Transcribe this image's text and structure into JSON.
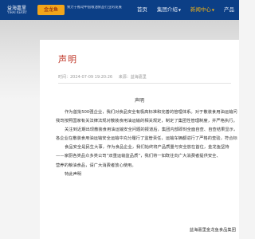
{
  "header": {
    "brand_cn": "益海嘉里",
    "brand_en": "YIHAI KERRY",
    "badge_text": "金龙鱼",
    "tagline": "致力于推动中国粮油食品行业的发展",
    "nav": [
      {
        "label": "首页",
        "active": false,
        "caret": false
      },
      {
        "label": "集团介绍",
        "active": false,
        "caret": true
      },
      {
        "label": "新闻中心",
        "active": true,
        "caret": true
      },
      {
        "label": "产品",
        "active": false,
        "caret": false
      }
    ]
  },
  "article": {
    "title": "声明",
    "date": "时间：2024-07-09 19:20:26",
    "source": "来源：益海嘉里",
    "doc_title": "声明",
    "paragraphs": [
      {
        "text": "作为首批500强企业，我们对食品安全有极高标准和完善的管理体系。对于散装食用油运输问题，",
        "indent": true
      },
      {
        "text": "我司按照国家有关法律法规对散装食用油运输的相关规定，制定了集团性管理制度，并严格执行。",
        "indent": false
      },
      {
        "text": "关注到近期出现散装食用油运输安全问题的报道后，集团内部即刻全面自查、自查结果显示，",
        "indent": true
      },
      {
        "text": "各企业在散装食用油运输安全运输中充分履行了监管责任，运输车辆都进行了严格的查验，符合标准。",
        "indent": false
      },
      {
        "text": "食品安全是民生大事，作为食品企业，我们始终将产品质量与安全放在首位，金龙鱼坚持",
        "indent": true
      },
      {
        "text": "——家厨各类品众多类公司“双重运输监品质”，我们将一如既往向广大消费者提供安全、",
        "indent": false
      },
      {
        "text": "营养的粮油食品，请广大消费者放心使用。",
        "indent": false
      },
      {
        "text": "特此声明",
        "indent": true
      }
    ],
    "signature": "益海嘉里金龙鱼食品集团"
  }
}
